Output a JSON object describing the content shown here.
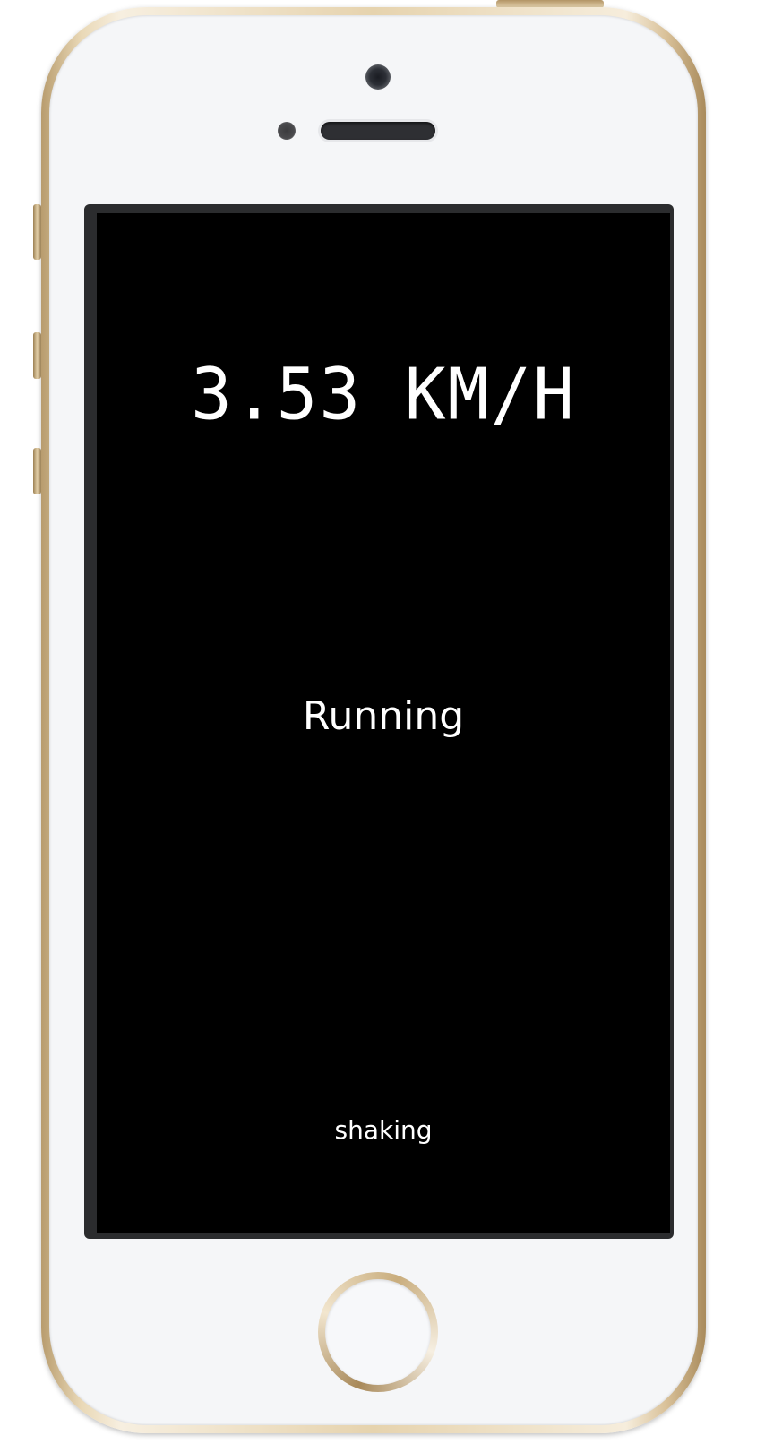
{
  "app": {
    "speed_readout": "3.53 KM/H",
    "activity": "Running",
    "motion_state": "shaking"
  },
  "theme": {
    "screen_background": "#000000",
    "text_color": "#ffffff",
    "device_color": "gold"
  },
  "icons": {
    "camera": "front-camera-icon",
    "home": "home-button-icon"
  }
}
